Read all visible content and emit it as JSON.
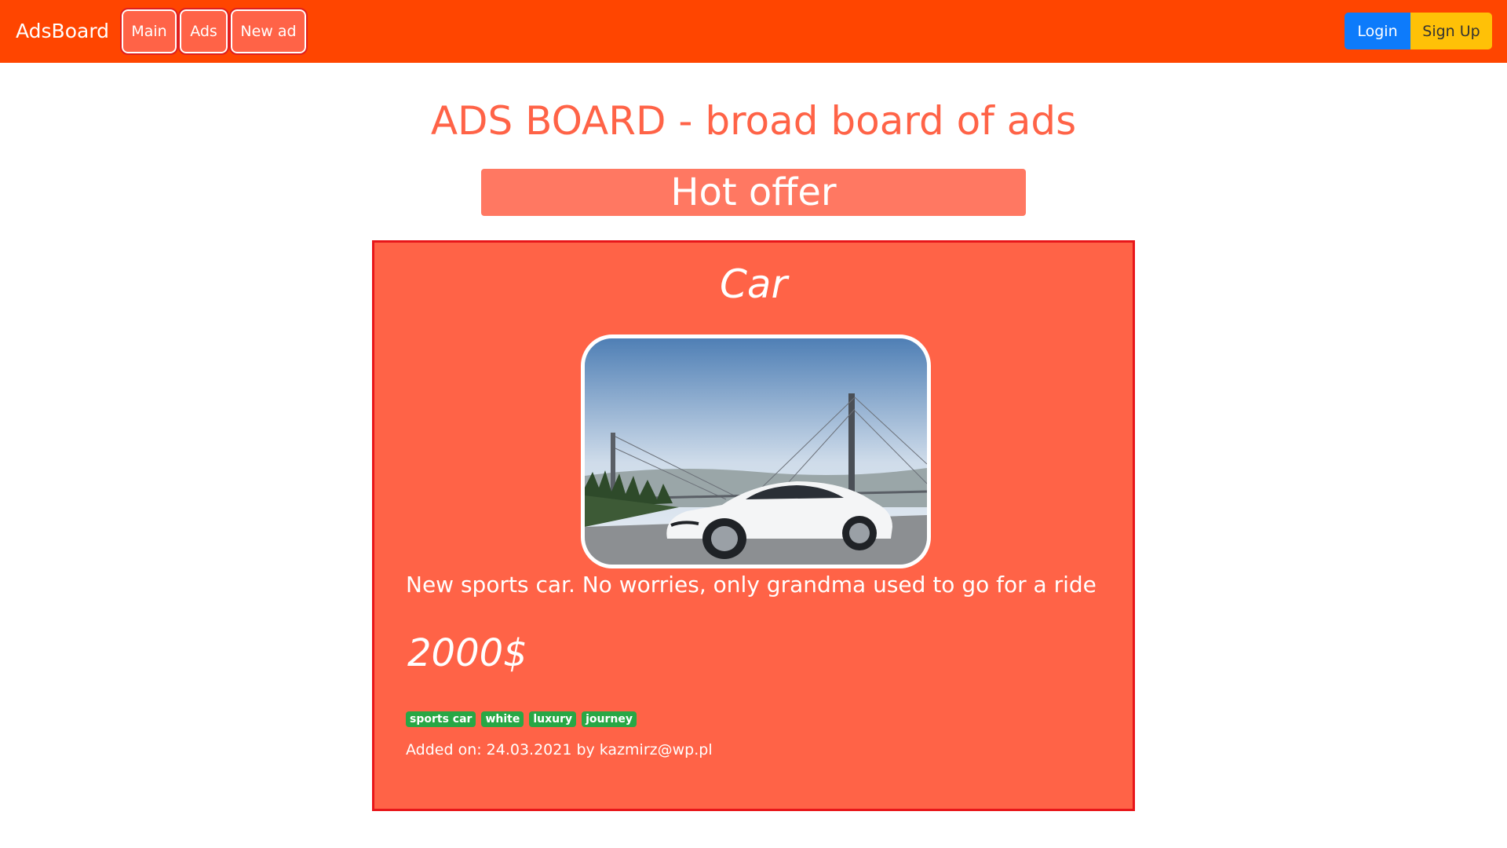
{
  "navbar": {
    "brand": "AdsBoard",
    "links": [
      {
        "label": "Main"
      },
      {
        "label": "Ads"
      },
      {
        "label": "New ad"
      }
    ],
    "login_label": "Login",
    "signup_label": "Sign Up"
  },
  "page": {
    "title": "ADS BOARD - broad board of ads",
    "hot_offer": "Hot offer"
  },
  "ad": {
    "title": "Car",
    "description": "New sports car. No worries, only grandma used to go for a ride",
    "price": "2000$",
    "tags": [
      "sports car",
      "white",
      "luxury",
      "journey"
    ],
    "added_on_label": "Added on:",
    "date": "24.03.2021",
    "by_label": "by",
    "author": "kazmirz@wp.pl"
  },
  "colors": {
    "navbar": "#ff4500",
    "accent": "#ff6347",
    "card_border": "#e8161a",
    "login": "#0d7bfb",
    "signup": "#ffc107",
    "tag": "#28a745"
  }
}
